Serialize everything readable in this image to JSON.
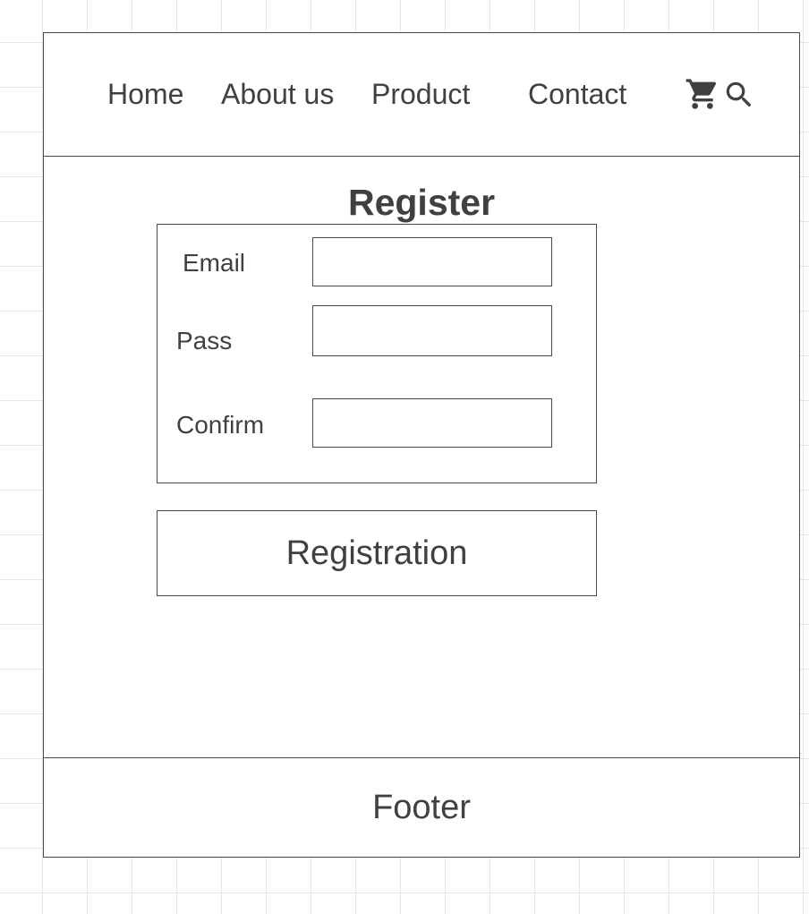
{
  "header": {
    "nav_items": [
      "Home",
      "About us",
      "Product",
      "Contact"
    ],
    "icons": [
      "cart-icon",
      "search-icon"
    ]
  },
  "main": {
    "title": "Register",
    "form": {
      "email_label": "Email",
      "email_value": "",
      "pass_label": "Pass",
      "pass_value": "",
      "confirm_label": "Confirm",
      "confirm_value": ""
    },
    "submit_label": "Registration"
  },
  "footer": {
    "label": "Footer"
  },
  "colors": {
    "stroke": "#4a4a4a",
    "text": "#404040",
    "grid": "#e6e6e6",
    "background": "#ffffff"
  }
}
